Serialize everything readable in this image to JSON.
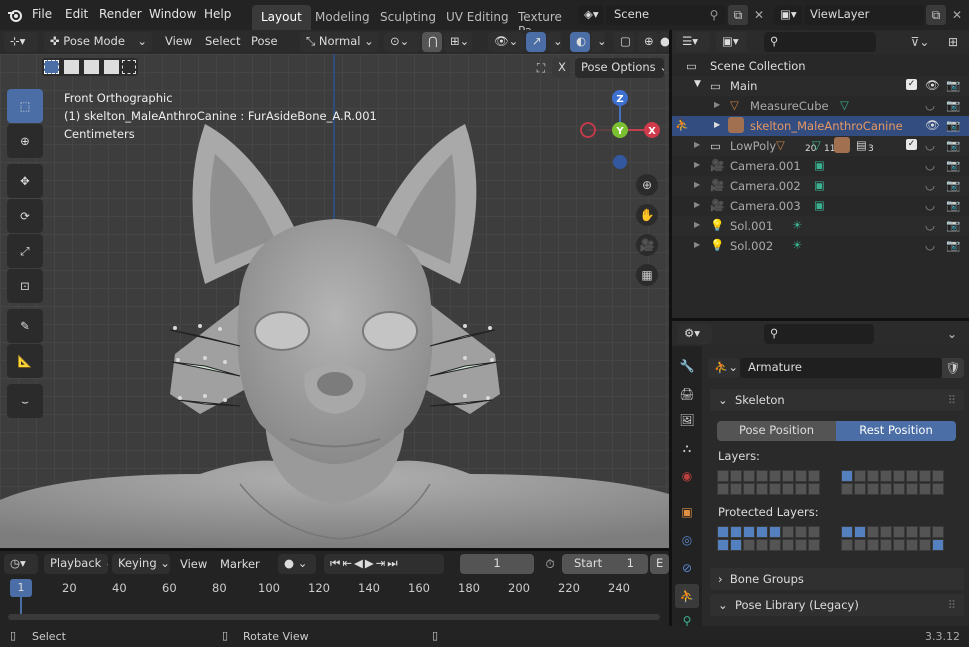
{
  "menu": [
    "File",
    "Edit",
    "Render",
    "Window",
    "Help"
  ],
  "workspace_tabs": [
    "Layout",
    "Modeling",
    "Sculpting",
    "UV Editing",
    "Texture Pa"
  ],
  "scene": {
    "name": "Scene",
    "view_layer": "ViewLayer"
  },
  "viewport_header": {
    "mode": "Pose Mode",
    "view": "View",
    "select": "Select",
    "pose": "Pose",
    "orientation": "Normal",
    "pose_options": "Pose Options",
    "x_label": "X"
  },
  "viewport_overlay": {
    "line1": "Front Orthographic",
    "line2": "(1) skelton_MaleAnthroCanine : FurAsideBone_A.R.001",
    "line3": "Centimeters"
  },
  "gizmo": {
    "z": "Z",
    "y": "Y",
    "x": "X"
  },
  "outliner": {
    "search_placeholder": "",
    "rows": [
      {
        "label": "Scene Collection"
      },
      {
        "label": "Main"
      },
      {
        "label": "MeasureCube"
      },
      {
        "label": "skelton_MaleAnthroCanine"
      },
      {
        "label": "LowPoly",
        "badges": [
          "20",
          "11",
          "3"
        ]
      },
      {
        "label": "Camera.001"
      },
      {
        "label": "Camera.002"
      },
      {
        "label": "Camera.003"
      },
      {
        "label": "Sol.001"
      },
      {
        "label": "Sol.002"
      }
    ]
  },
  "properties": {
    "object_name": "Armature",
    "skeleton_panel": "Skeleton",
    "pose_position": "Pose Position",
    "rest_position": "Rest Position",
    "layers_label": "Layers:",
    "protected_label": "Protected Layers:",
    "bone_groups": "Bone Groups",
    "pose_library": "Pose Library (Legacy)"
  },
  "timeline": {
    "playback": "Playback",
    "keying": "Keying",
    "view": "View",
    "marker": "Marker",
    "current_frame": "1",
    "start_label": "Start",
    "start_value": "1",
    "end_label": "E",
    "playhead": "1",
    "ticks": [
      "20",
      "40",
      "60",
      "80",
      "100",
      "120",
      "140",
      "160",
      "180",
      "200",
      "220",
      "240"
    ]
  },
  "status": {
    "select": "Select",
    "rotate": "Rotate View",
    "version": "3.3.12"
  },
  "colors": {
    "accent": "#4a6ea5",
    "selection": "#334d80",
    "background": "#3d3d3d",
    "object_orange": "#e0965a"
  }
}
